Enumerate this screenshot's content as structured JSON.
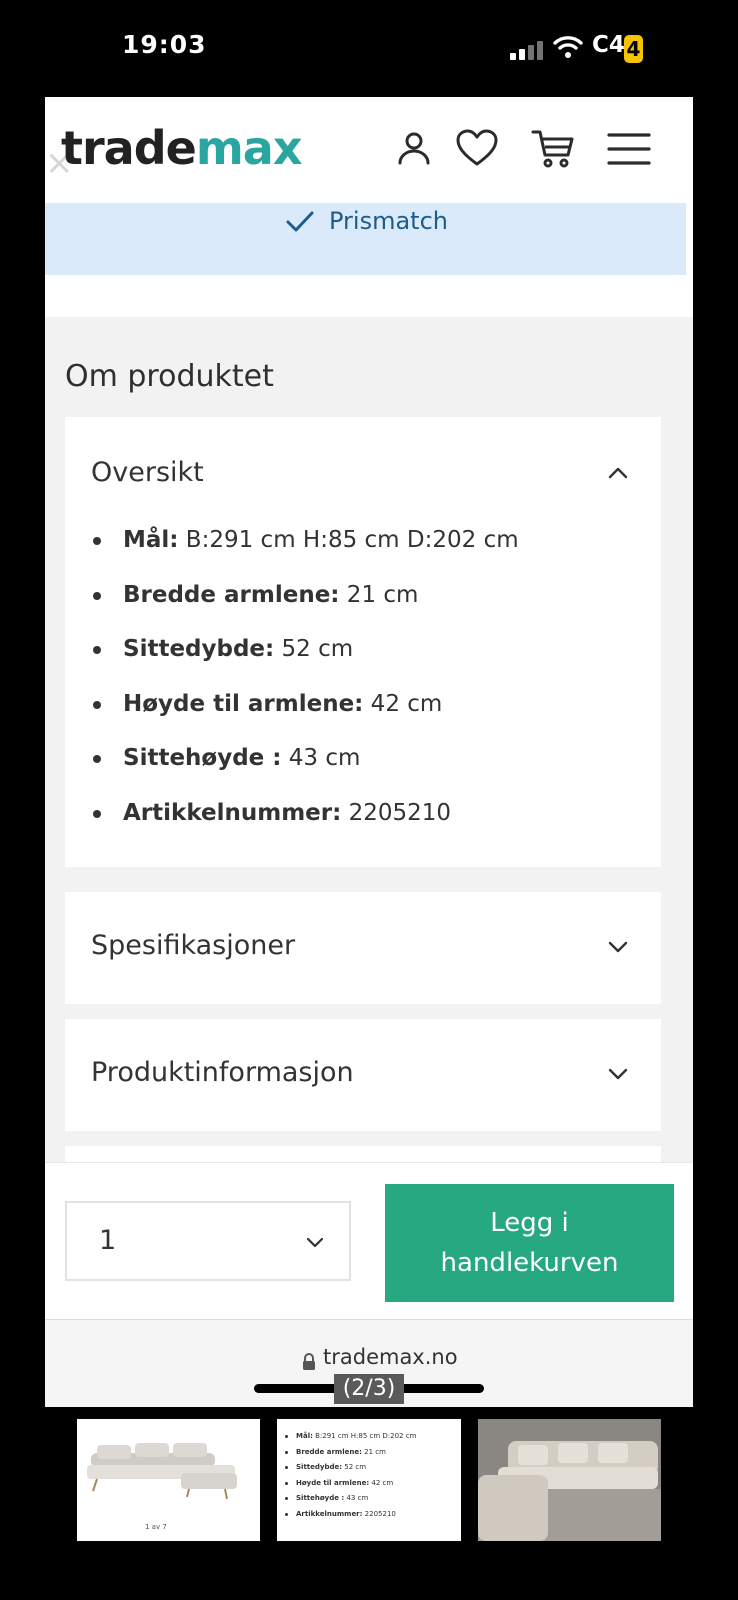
{
  "status_bar": {
    "time": "19:03",
    "battery_text": "C4",
    "battery_level": "4"
  },
  "header": {
    "logo_part1": "trade",
    "logo_part2": "max",
    "close_glyph": "×"
  },
  "prismatch": {
    "label": "Prismatch"
  },
  "about": {
    "title": "Om produktet",
    "overview": {
      "title": "Oversikt",
      "items": [
        {
          "key": "Mål:",
          "value": " B:291 cm H:85 cm D:202 cm"
        },
        {
          "key": "Bredde armlene:",
          "value": " 21 cm"
        },
        {
          "key": "Sittedybde:",
          "value": " 52 cm"
        },
        {
          "key": "Høyde til armlene:",
          "value": " 42 cm"
        },
        {
          "key": "Sittehøyde :",
          "value": " 43 cm"
        },
        {
          "key": "Artikkelnummer:",
          "value": " 2205210"
        }
      ]
    },
    "specs_title": "Spesifikasjoner",
    "product_info_title": "Produktinformasjon"
  },
  "purchase": {
    "quantity": "1",
    "add_to_cart_line1": "Legg i",
    "add_to_cart_line2": "handlekurven"
  },
  "browser": {
    "url": "trademax.no"
  },
  "gallery": {
    "counter": "(2/3)",
    "thumb1_caption": "1 av 7"
  },
  "colors": {
    "accent_teal": "#2aa5a0",
    "cart_green": "#26a880",
    "prismatch_bg": "#dbeafa"
  },
  "icons": [
    "user-icon",
    "heart-icon",
    "cart-icon",
    "menu-icon",
    "check-icon",
    "chevron-up-icon",
    "chevron-down-icon",
    "lock-icon"
  ]
}
